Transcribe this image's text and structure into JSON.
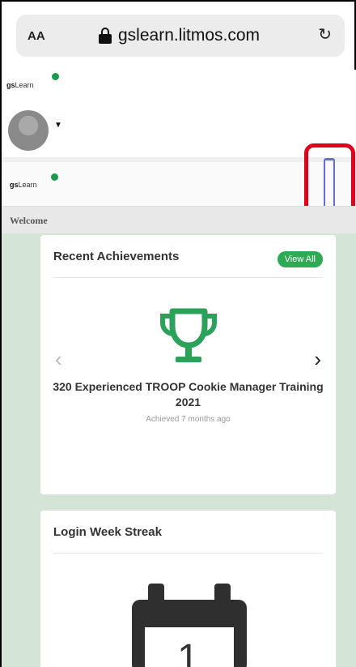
{
  "browser": {
    "text_size_label": "AA",
    "url": "gslearn.litmos.com"
  },
  "header": {
    "logo_text_bold": "gs",
    "logo_text": "Learn",
    "welcome": "Welcome"
  },
  "achievements": {
    "title": "Recent Achievements",
    "view_all_label": "View All",
    "item_title": "320 Experienced TROOP Cookie Manager Training 2021",
    "item_subtitle": "Achieved 7 months ago"
  },
  "streak": {
    "title": "Login Week Streak",
    "count": "1"
  },
  "colors": {
    "brand_green": "#2eaa55",
    "content_bg": "#d4e5d8",
    "highlight": "#e0001b"
  }
}
